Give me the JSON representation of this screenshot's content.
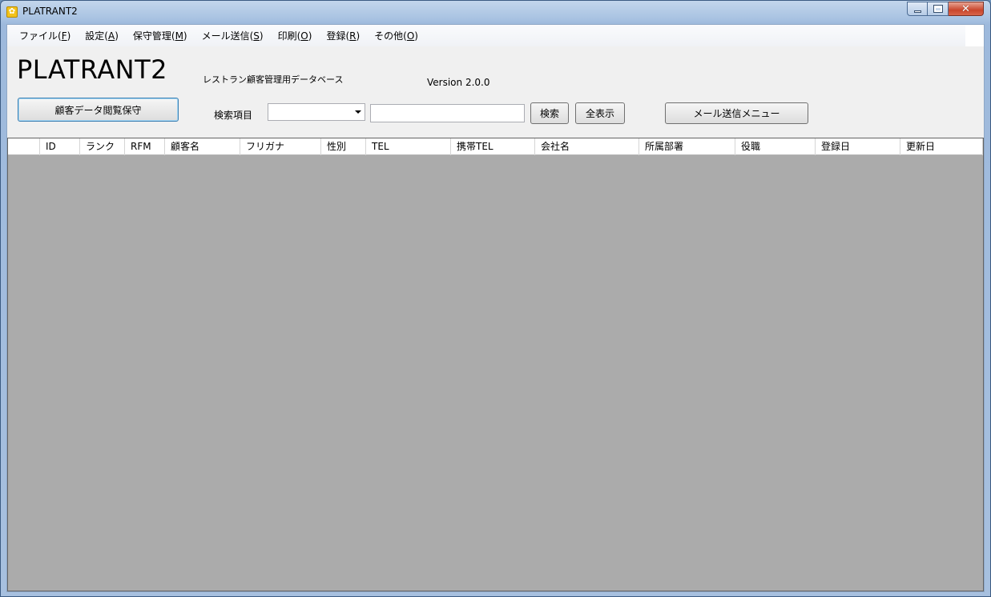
{
  "window": {
    "title": "PLATRANT2"
  },
  "menu": [
    {
      "label": "ファイル(",
      "key": "F",
      "suffix": ")"
    },
    {
      "label": "設定(",
      "key": "A",
      "suffix": ")"
    },
    {
      "label": "保守管理(",
      "key": "M",
      "suffix": ")"
    },
    {
      "label": "メール送信(",
      "key": "S",
      "suffix": ")"
    },
    {
      "label": "印刷(",
      "key": "O",
      "suffix": ")"
    },
    {
      "label": "登録(",
      "key": "R",
      "suffix": ")"
    },
    {
      "label": "その他(",
      "key": "O",
      "suffix": ")"
    }
  ],
  "header": {
    "logo": "PLATRANT2",
    "subtitle": "レストラン顧客管理用データベース",
    "version": "Version 2.0.0"
  },
  "toolbar": {
    "customer_data_button": "顧客データ閲覧保守",
    "search_label": "検索項目",
    "search_field_value": "",
    "search_text_value": "",
    "search_button": "検索",
    "show_all_button": "全表示",
    "mail_menu_button": "メール送信メニュー"
  },
  "grid": {
    "columns": [
      "",
      "ID",
      "ランク",
      "RFM",
      "顧客名",
      "フリガナ",
      "性別",
      "TEL",
      "携帯TEL",
      "会社名",
      "所属部署",
      "役職",
      "登録日",
      "更新日"
    ]
  }
}
